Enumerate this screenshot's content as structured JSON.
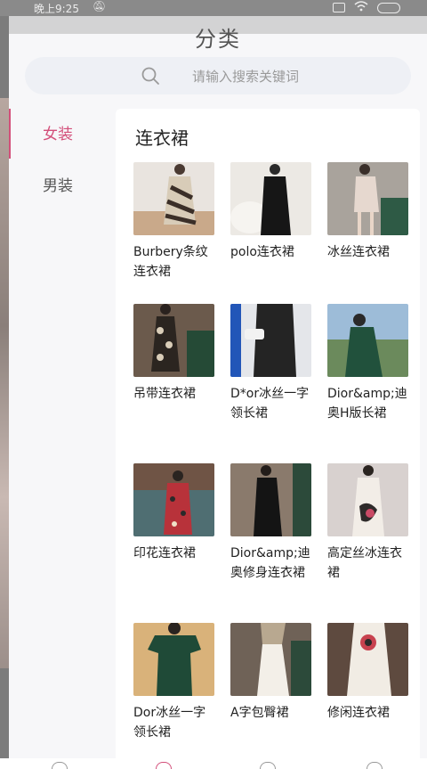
{
  "status_bar": {
    "time": "晚上9:25",
    "mute_icon": "bell-off-icon"
  },
  "page": {
    "title": "分类"
  },
  "search": {
    "placeholder": "请输入搜索关键词"
  },
  "categories": [
    {
      "label": "女装",
      "active": true
    },
    {
      "label": "男装",
      "active": false
    }
  ],
  "section": {
    "title": "连衣裙"
  },
  "products": [
    {
      "name": "Burbery条纹连衣裙"
    },
    {
      "name": "polo连衣裙"
    },
    {
      "name": "冰丝连衣裙"
    },
    {
      "name": "吊带连衣裙"
    },
    {
      "name": "D*or冰丝一字领长裙"
    },
    {
      "name": "Dior&amp;迪奥H版长裙"
    },
    {
      "name": "印花连衣裙"
    },
    {
      "name": "Dior&amp;迪奥修身连衣裙"
    },
    {
      "name": "高定丝冰连衣裙"
    },
    {
      "name": "Dor冰丝一字领长裙"
    },
    {
      "name": "A字包臀裙"
    },
    {
      "name": "修闲连衣裙"
    }
  ],
  "colors": {
    "accent": "#d34f7a",
    "sheet_bg": "#f7f7f9",
    "search_bg": "#eef0f5"
  }
}
